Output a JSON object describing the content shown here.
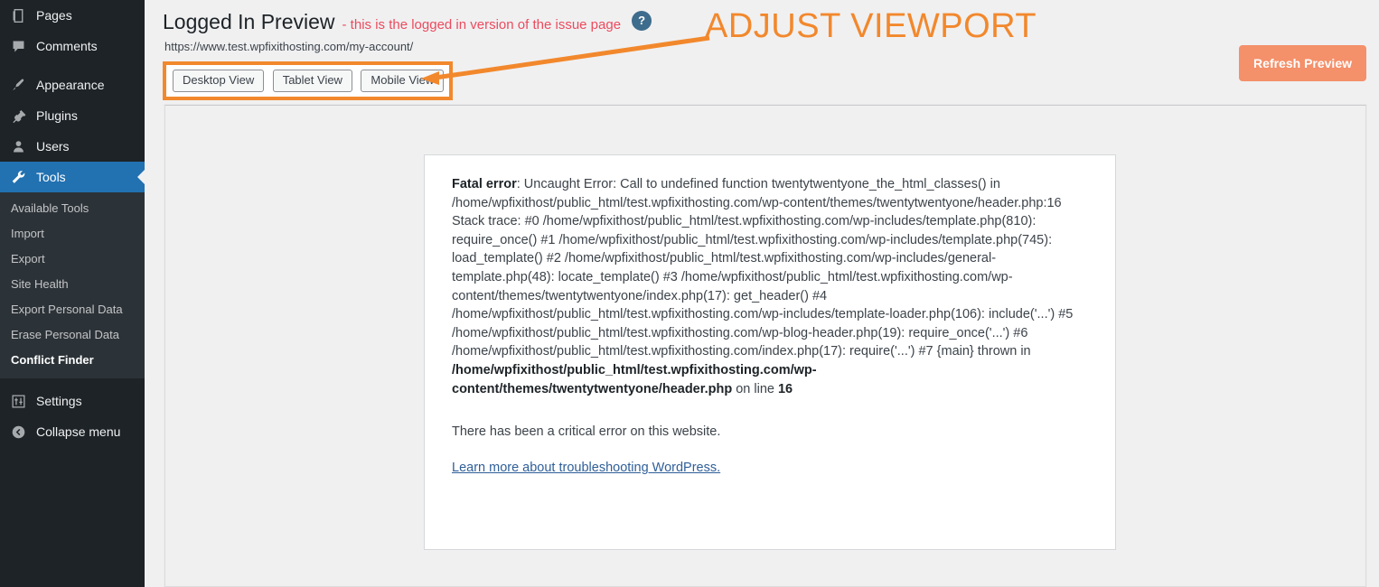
{
  "sidebar": {
    "top_items": [
      {
        "label": "Pages",
        "icon": "pages-icon"
      },
      {
        "label": "Comments",
        "icon": "comments-icon"
      }
    ],
    "mid_items": [
      {
        "label": "Appearance",
        "icon": "appearance-icon"
      },
      {
        "label": "Plugins",
        "icon": "plugins-icon"
      },
      {
        "label": "Users",
        "icon": "users-icon"
      }
    ],
    "current_item": {
      "label": "Tools",
      "icon": "tools-icon"
    },
    "submenu": [
      {
        "label": "Available Tools",
        "active": false
      },
      {
        "label": "Import",
        "active": false
      },
      {
        "label": "Export",
        "active": false
      },
      {
        "label": "Site Health",
        "active": false
      },
      {
        "label": "Export Personal Data",
        "active": false
      },
      {
        "label": "Erase Personal Data",
        "active": false
      },
      {
        "label": "Conflict Finder",
        "active": true
      }
    ],
    "bottom_items": [
      {
        "label": "Settings",
        "icon": "settings-icon"
      },
      {
        "label": "Collapse menu",
        "icon": "collapse-icon"
      }
    ]
  },
  "header": {
    "title": "Logged In Preview",
    "subtitle": "- this is the logged in version of the issue page",
    "help_glyph": "?",
    "preview_url": "https://www.test.wpfixithosting.com/my-account/",
    "viewport_buttons": [
      {
        "label": "Desktop View"
      },
      {
        "label": "Tablet View"
      },
      {
        "label": "Mobile View"
      }
    ],
    "annotation_label": "ADJUST VIEWPORT",
    "refresh_label": "Refresh Preview",
    "accent_orange": "#f2882c",
    "subtitle_color": "#ec4b5e",
    "refresh_bg": "#f4906a",
    "current_menu_blue": "#2271b1"
  },
  "preview": {
    "error_label": "Fatal error",
    "error_text": ": Uncaught Error: Call to undefined function twentytwentyone_the_html_classes() in /home/wpfixithost/public_html/test.wpfixithosting.com/wp-content/themes/twentytwentyone/header.php:16 Stack trace: #0 /home/wpfixithost/public_html/test.wpfixithosting.com/wp-includes/template.php(810): require_once() #1 /home/wpfixithost/public_html/test.wpfixithosting.com/wp-includes/template.php(745): load_template() #2 /home/wpfixithost/public_html/test.wpfixithosting.com/wp-includes/general-template.php(48): locate_template() #3 /home/wpfixithost/public_html/test.wpfixithosting.com/wp-content/themes/twentytwentyone/index.php(17): get_header() #4 /home/wpfixithost/public_html/test.wpfixithosting.com/wp-includes/template-loader.php(106): include('...') #5 /home/wpfixithost/public_html/test.wpfixithosting.com/wp-blog-header.php(19): require_once('...') #6 /home/wpfixithost/public_html/test.wpfixithosting.com/index.php(17): require('...') #7 {main} thrown in ",
    "error_file": "/home/wpfixithost/public_html/test.wpfixithosting.com/wp-content/themes/twentytwentyone/header.php",
    "error_on_line": " on line ",
    "error_line_number": "16",
    "critical_message": "There has been a critical error on this website.",
    "learn_more_link": "Learn more about troubleshooting WordPress."
  }
}
